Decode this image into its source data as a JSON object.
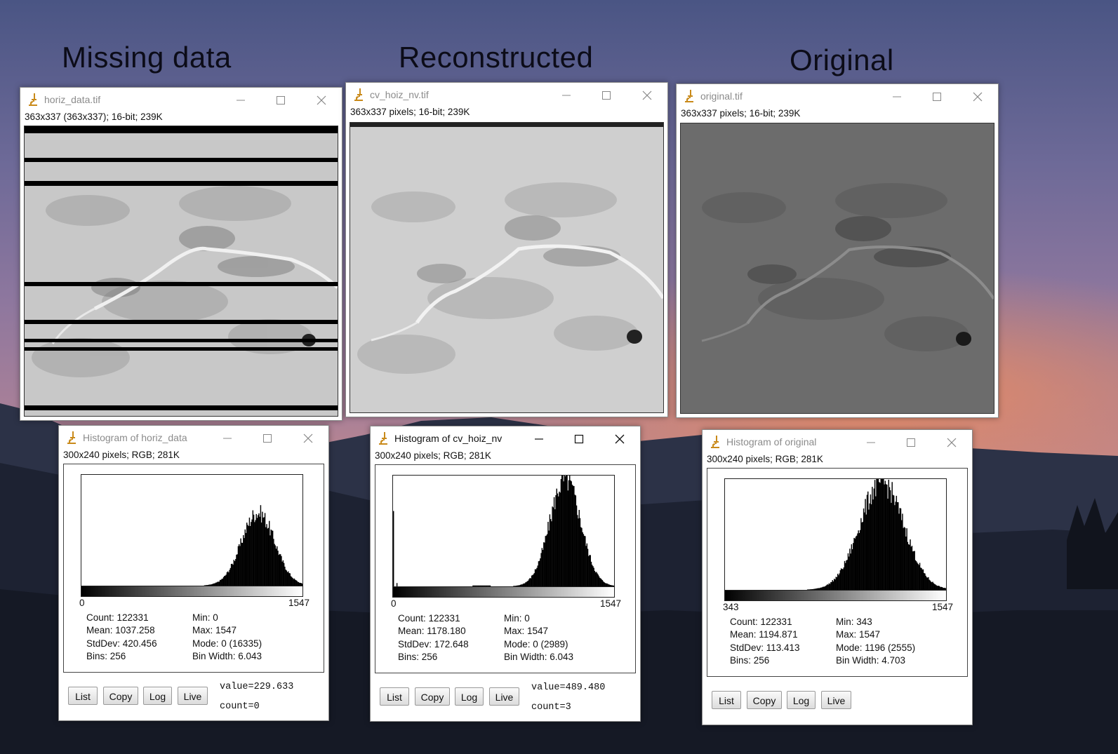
{
  "headings": {
    "missing": "Missing data",
    "reconstructed": "Reconstructed",
    "original": "Original"
  },
  "image_windows": [
    {
      "title": "horiz_data.tif",
      "info": "363x337   (363x337); 16-bit; 239K",
      "tone": "#bdbdbd",
      "has_gaps": true,
      "active": false
    },
    {
      "title": "cv_hoiz_nv.tif",
      "info": "363x337 pixels; 16-bit; 239K",
      "tone": "#c9c9c9",
      "has_gaps": false,
      "active": false
    },
    {
      "title": "original.tif",
      "info": "363x337 pixels; 16-bit; 239K",
      "tone": "#6e6e6e",
      "has_gaps": false,
      "active": false
    }
  ],
  "histogram_windows": [
    {
      "title": "Histogram of horiz_data",
      "active": false,
      "info": "300x240 pixels; RGB; 281K",
      "axis_min": "0",
      "axis_max": "1547",
      "count": "Count: 122331",
      "mean": "Mean: 1037.258",
      "stddev": "StdDev: 420.456",
      "bins": "Bins: 256",
      "min": "Min: 0",
      "max": "Max: 1547",
      "mode": "Mode: 0 (16335)",
      "binwidth": "Bin Width: 6.043",
      "value": "value=229.633",
      "countv": "count=0",
      "shape": {
        "center": 0.8,
        "sigma": 0.075,
        "peak": 0.66,
        "spike0": 0,
        "hump": 0
      }
    },
    {
      "title": "Histogram of cv_hoiz_nv",
      "active": true,
      "info": "300x240 pixels; RGB; 281K",
      "axis_min": "0",
      "axis_max": "1547",
      "count": "Count: 122331",
      "mean": "Mean: 1178.180",
      "stddev": "StdDev: 172.648",
      "bins": "Bins: 256",
      "min": "Min: 0",
      "max": "Max: 1547",
      "mode": "Mode: 0 (2989)",
      "binwidth": "Bin Width: 6.043",
      "value": "value=489.480",
      "countv": "count=3",
      "shape": {
        "center": 0.78,
        "sigma": 0.07,
        "peak": 0.97,
        "spike0": 0.68,
        "hump": 1
      }
    },
    {
      "title": "Histogram of original",
      "active": false,
      "info": "300x240 pixels; RGB; 281K",
      "axis_min": "343",
      "axis_max": "1547",
      "count": "Count: 122331",
      "mean": "Mean: 1194.871",
      "stddev": "StdDev: 113.413",
      "bins": "Bins: 256",
      "min": "Min: 343",
      "max": "Max: 1547",
      "mode": "Mode: 1196 (2555)",
      "binwidth": "Bin Width: 4.703",
      "value": "",
      "countv": "",
      "shape": {
        "center": 0.71,
        "sigma": 0.1,
        "peak": 0.97,
        "spike0": 0,
        "hump": 0
      }
    }
  ],
  "buttons": {
    "list": "List",
    "copy": "Copy",
    "log": "Log",
    "live": "Live"
  },
  "icons": {
    "app": "imagej-microscope-icon",
    "minimize": "minimize-icon",
    "maximize": "maximize-icon",
    "close": "close-icon"
  }
}
